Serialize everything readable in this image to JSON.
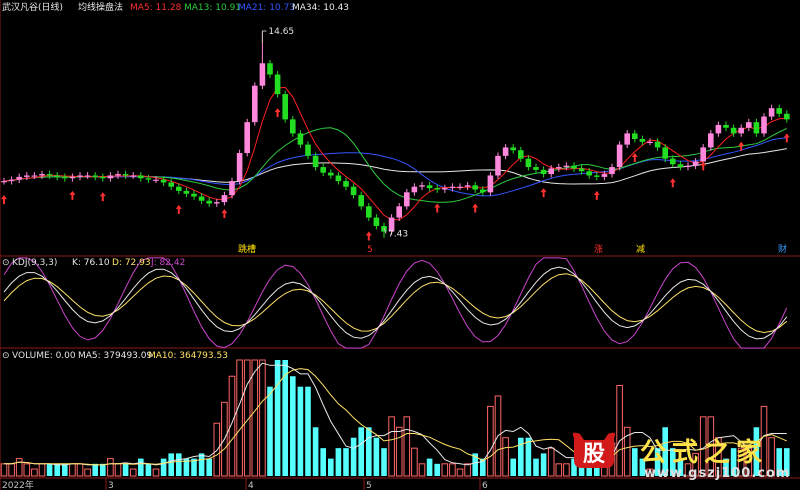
{
  "main_panel": {
    "stock_name": "武汉凡谷(日线)",
    "indicator_name": "均线操盘法",
    "ma_labels": [
      {
        "text": "MA5: 11.28",
        "color": "#ff3030"
      },
      {
        "text": "MA13: 10.91",
        "color": "#2ecc40"
      },
      {
        "text": "MA21: 10.73",
        "color": "#3355ff"
      },
      {
        "text": "MA34: 10.43",
        "color": "#e8e8e8"
      }
    ],
    "high_label": "14.65",
    "low_label": "7.43",
    "signal_tags": [
      {
        "text": "跳槽",
        "color": "#ffe000"
      },
      {
        "text": "5",
        "color": "#ff3030"
      },
      {
        "text": "涨",
        "color": "#ff3030"
      },
      {
        "text": "减",
        "color": "#ffe000"
      },
      {
        "text": "财",
        "color": "#3399ff"
      }
    ]
  },
  "kdj_panel": {
    "title": "KDJ(9,3,3)",
    "k_label": "K: 76.10",
    "d_label": "D: 72.93",
    "j_label": "J: 82.42",
    "colors": {
      "k": "#e8e8e8",
      "d": "#ffe066",
      "j": "#cc44cc"
    }
  },
  "volume_panel": {
    "title": "VOLUME: 0.00",
    "ma5_label": "MA5: 379493.09",
    "ma10_label": "MA10: 364793.53"
  },
  "x_axis": {
    "labels": [
      "2022年",
      "3",
      "4",
      "5",
      "6"
    ]
  },
  "watermark": {
    "logo_text": "股",
    "title": "公式之家",
    "url": "www.gszj100.com"
  },
  "chart_data": {
    "type": "candlestick",
    "title": "均线操盘法",
    "series_count": 104,
    "x_ticks": [
      "2022年",
      "3",
      "4",
      "5",
      "6"
    ],
    "price_range": [
      7.43,
      14.65
    ],
    "closes": [
      9.3,
      9.35,
      9.45,
      9.5,
      9.5,
      9.55,
      9.5,
      9.45,
      9.4,
      9.45,
      9.5,
      9.5,
      9.45,
      9.4,
      9.5,
      9.55,
      9.5,
      9.5,
      9.4,
      9.35,
      9.35,
      9.25,
      9.1,
      8.95,
      8.85,
      8.75,
      8.6,
      8.5,
      8.55,
      8.8,
      9.3,
      10.3,
      11.4,
      12.7,
      13.5,
      13.1,
      12.4,
      11.5,
      11.0,
      10.6,
      10.2,
      9.8,
      9.6,
      9.5,
      9.3,
      9.1,
      8.8,
      8.4,
      8.0,
      7.7,
      7.5,
      8.0,
      8.4,
      8.9,
      9.1,
      9.15,
      9.05,
      9.0,
      9.05,
      9.1,
      9.1,
      9.15,
      9.0,
      8.9,
      9.5,
      10.2,
      10.5,
      10.4,
      10.1,
      9.8,
      9.7,
      9.55,
      9.75,
      9.8,
      9.85,
      9.75,
      9.65,
      9.5,
      9.45,
      9.55,
      9.8,
      10.6,
      11.0,
      10.8,
      10.7,
      10.7,
      10.5,
      10.1,
      9.9,
      9.8,
      9.85,
      10.0,
      10.5,
      11.0,
      11.3,
      11.2,
      11.0,
      11.2,
      11.4,
      11.0,
      11.6,
      11.9,
      11.7,
      11.5
    ],
    "kdj": {
      "K": 76.1,
      "D": 72.93,
      "J": 82.42
    },
    "volume_ma": {
      "MA5": 379493.09,
      "MA10": 364793.53
    }
  }
}
